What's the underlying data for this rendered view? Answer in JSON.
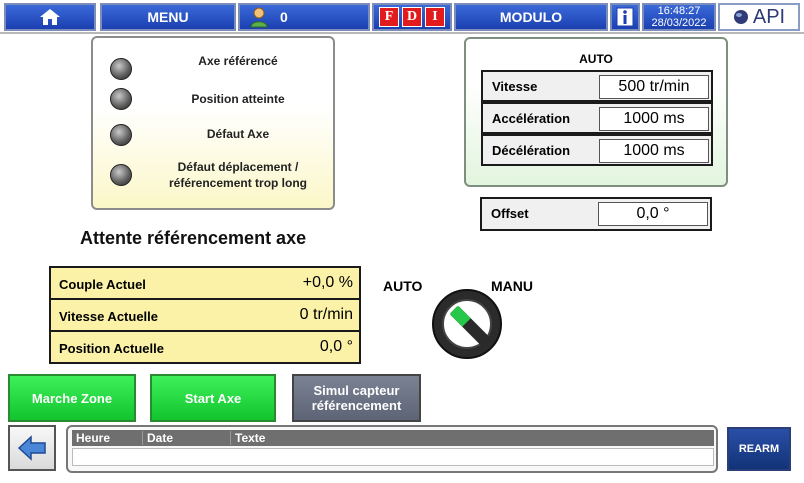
{
  "topbar": {
    "home_icon": "home-icon",
    "menu_label": "MENU",
    "user_icon": "user-icon",
    "user_count": "0",
    "fdi_letters": [
      "F",
      "D",
      "I"
    ],
    "modulo_label": "MODULO",
    "info_icon": "info-icon",
    "time": "16:48:27",
    "date": "28/03/2022",
    "logo_text": "API",
    "colors": {
      "bar": "#1b3fb0",
      "fdi": "#e21c1c"
    }
  },
  "status": {
    "items": [
      {
        "label": "Axe référencé"
      },
      {
        "label": "Position atteinte"
      },
      {
        "label": "Défaut Axe"
      },
      {
        "label": "Défaut déplacement / référencement trop long"
      }
    ]
  },
  "auto_panel": {
    "title": "AUTO",
    "params": [
      {
        "label": "Vitesse",
        "value": "500 tr/min"
      },
      {
        "label": "Accélération",
        "value": "1000 ms"
      },
      {
        "label": "Décélération",
        "value": "1000 ms"
      }
    ]
  },
  "offset": {
    "label": "Offset",
    "value": "0,0 °"
  },
  "heading": "Attente référencement axe",
  "actuals": [
    {
      "label": "Couple Actuel",
      "value": "+0,0 %"
    },
    {
      "label": "Vitesse Actuelle",
      "value": "0 tr/min"
    },
    {
      "label": "Position Actuelle",
      "value": "0,0 °"
    }
  ],
  "selector": {
    "left_label": "AUTO",
    "right_label": "MANU",
    "position": "AUTO"
  },
  "buttons": {
    "marche_zone": "Marche Zone",
    "start_axe": "Start Axe",
    "simul_capteur": "Simul capteur référencement"
  },
  "alarms": {
    "columns": [
      "Heure",
      "Date",
      "Texte"
    ],
    "back_icon": "back-arrow-icon",
    "rearm_label": "REARM"
  }
}
